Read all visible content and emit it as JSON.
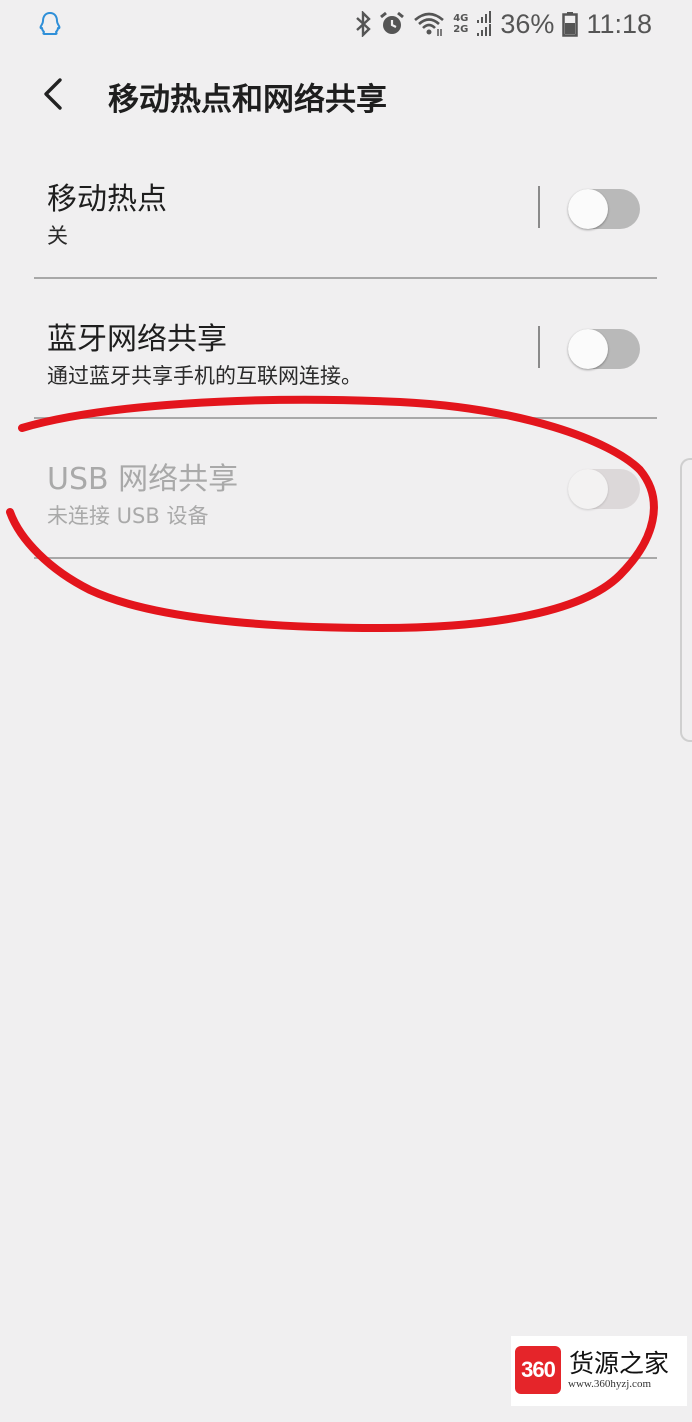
{
  "status_bar": {
    "app_icon": "qq-penguin-icon",
    "network_top": "4G",
    "network_bottom": "2G",
    "battery_percent": "36%",
    "time": "11:18",
    "icons": [
      "bluetooth-icon",
      "alarm-icon",
      "wifi-icon",
      "signal-icon",
      "battery-icon"
    ]
  },
  "header": {
    "back_icon": "back-arrow-icon",
    "title": "移动热点和网络共享"
  },
  "settings": [
    {
      "title": "移动热点",
      "subtitle": "关",
      "enabled": true,
      "on": false
    },
    {
      "title": "蓝牙网络共享",
      "subtitle": "通过蓝牙共享手机的互联网连接。",
      "enabled": true,
      "on": false
    },
    {
      "title": "USB 网络共享",
      "subtitle": "未连接 USB 设备",
      "enabled": false,
      "on": false
    }
  ],
  "annotation": {
    "color": "#e3151c",
    "shape": "hand-drawn-circle"
  },
  "watermark": {
    "logo_text": "360",
    "name": "货源之家",
    "url": "www.360hyzj.com"
  },
  "colors": {
    "background": "#f0eff0",
    "toggle_off": "#b9b9b9",
    "divider": "#a8a8a8"
  }
}
